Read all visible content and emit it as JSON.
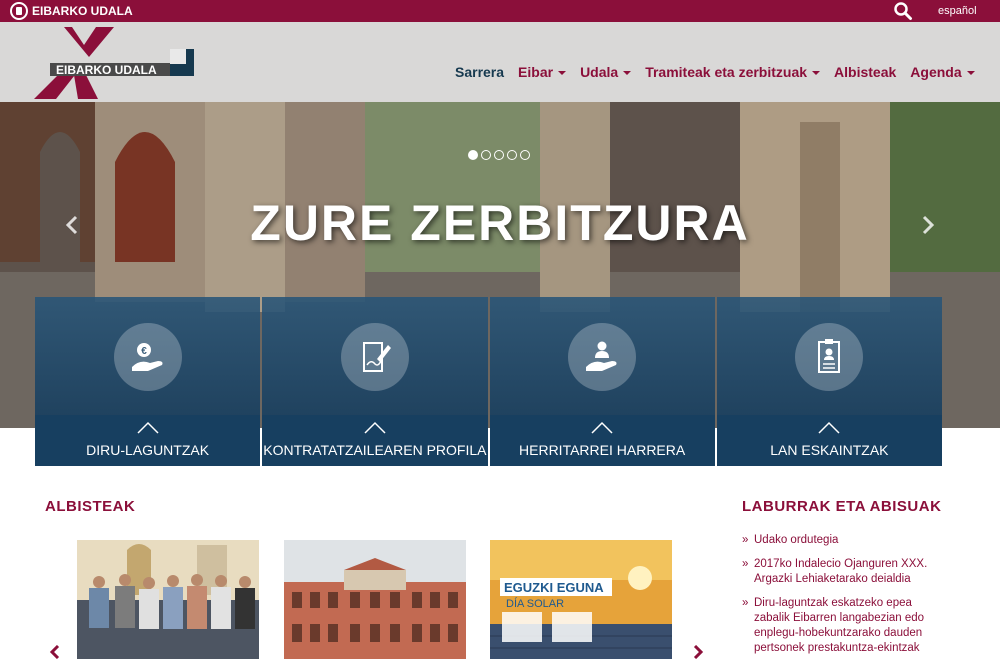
{
  "topbar": {
    "brand": "EIBARKO UDALA",
    "language": "español"
  },
  "header": {
    "logo_text": "EIBARKO UDALA",
    "nav": [
      {
        "label": "Sarrera",
        "dropdown": false,
        "active": true
      },
      {
        "label": "Eibar",
        "dropdown": true,
        "active": false
      },
      {
        "label": "Udala",
        "dropdown": true,
        "active": false
      },
      {
        "label": "Tramiteak eta zerbitzuak",
        "dropdown": true,
        "active": false
      },
      {
        "label": "Albisteak",
        "dropdown": false,
        "active": false
      },
      {
        "label": "Agenda",
        "dropdown": true,
        "active": false
      }
    ]
  },
  "hero": {
    "slogan": "ZURE ZERBITZURA",
    "slides_total": 5,
    "active_slide": 1
  },
  "tiles": [
    {
      "label": "DIRU-LAGUNTZAK",
      "icon": "hand-money-icon"
    },
    {
      "label": "KONTRATATZAILEAREN PROFILA",
      "icon": "document-pen-icon"
    },
    {
      "label": "HERRITARREI HARRERA",
      "icon": "hand-person-icon"
    },
    {
      "label": "LAN ESKAINTZAK",
      "icon": "id-card-icon"
    }
  ],
  "news": {
    "title": "ALBISTEAK",
    "poster": {
      "title": "EGUZKI EGUNA",
      "subtitle": "DÍA SOLAR"
    }
  },
  "notices": {
    "title": "LABURRAK ETA ABISUAK",
    "items": [
      "Udako ordutegia",
      "2017ko Indalecio Ojanguren XXX. Argazki Lehiaketarako deialdia",
      "Diru-laguntzak eskatzeko epea zabalik Eibarren langabezian edo enplegu-hobekuntzarako dauden pertsonek prestakuntza-ekintzak"
    ]
  },
  "colors": {
    "brand": "#8b0f3a",
    "navy": "#173f60",
    "nav_active": "#16394f"
  }
}
